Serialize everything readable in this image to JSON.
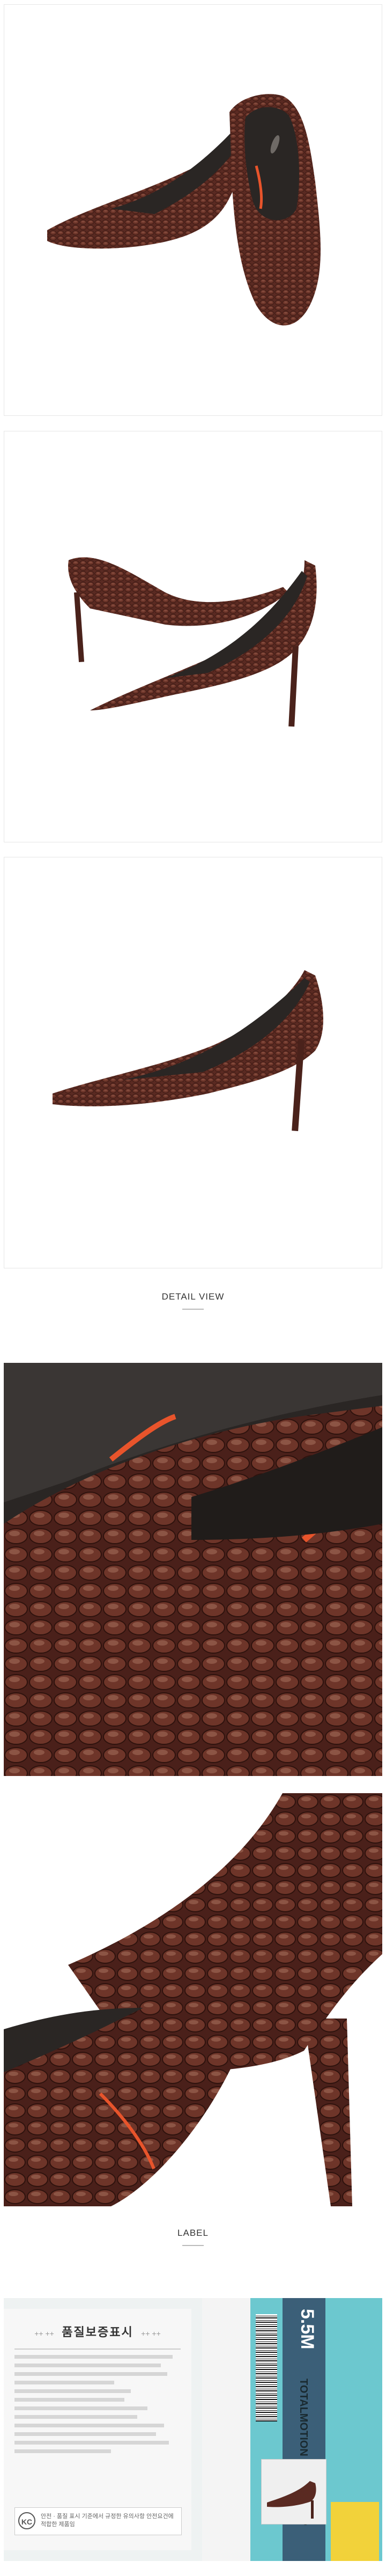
{
  "sections": {
    "detail_view": "DETAIL VIEW",
    "label": "LABEL"
  },
  "label_card": {
    "title": "품질보증표시",
    "stars_left": "++ ++",
    "stars_right": "++ ++",
    "notice": "안전 · 품질 표시 기준에서 규정한 유의사항 안전요건에 적합한 제품임"
  },
  "shoebox": {
    "size": "5.5M",
    "model": "TOTALMOTION PLAIN PUMP"
  },
  "colors": {
    "leather": "#5a2a22",
    "leather_highlight": "#a06a58",
    "lining": "#2a2624",
    "accent_orange": "#e8542b",
    "box_teal": "#6cc8cf",
    "box_yellow": "#f2d23a"
  }
}
